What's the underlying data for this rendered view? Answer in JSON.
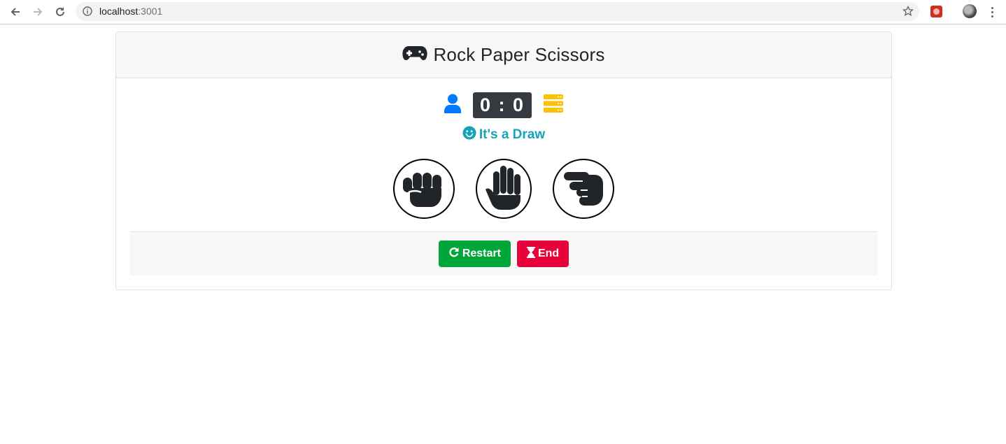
{
  "browser": {
    "url_host": "localhost",
    "url_port": ":3001",
    "icons": [
      "back-icon",
      "forward-icon",
      "reload-icon",
      "info-icon",
      "star-icon",
      "extension-icon",
      "profile-avatar",
      "menu-icon"
    ]
  },
  "header": {
    "title": "Rock Paper Scissors",
    "icon": "gamepad-icon"
  },
  "scoreboard": {
    "player_icon": "user-icon",
    "score": "0 : 0",
    "computer_icon": "server-icon",
    "colors": {
      "player": "#007bff",
      "computer": "#ffc107",
      "score_bg": "#343a40"
    }
  },
  "result": {
    "icon": "smile-icon",
    "text": "It's a Draw",
    "color": "#17a2b8"
  },
  "choices": [
    {
      "name": "rock",
      "icon": "hand-rock-icon"
    },
    {
      "name": "paper",
      "icon": "hand-paper-icon"
    },
    {
      "name": "scissors",
      "icon": "hand-scissors-icon"
    }
  ],
  "footer": {
    "restart_label": "Restart",
    "restart_icon": "redo-icon",
    "restart_color": "#00a63a",
    "end_label": "End",
    "end_icon": "hourglass-icon",
    "end_color": "#e8003a"
  }
}
